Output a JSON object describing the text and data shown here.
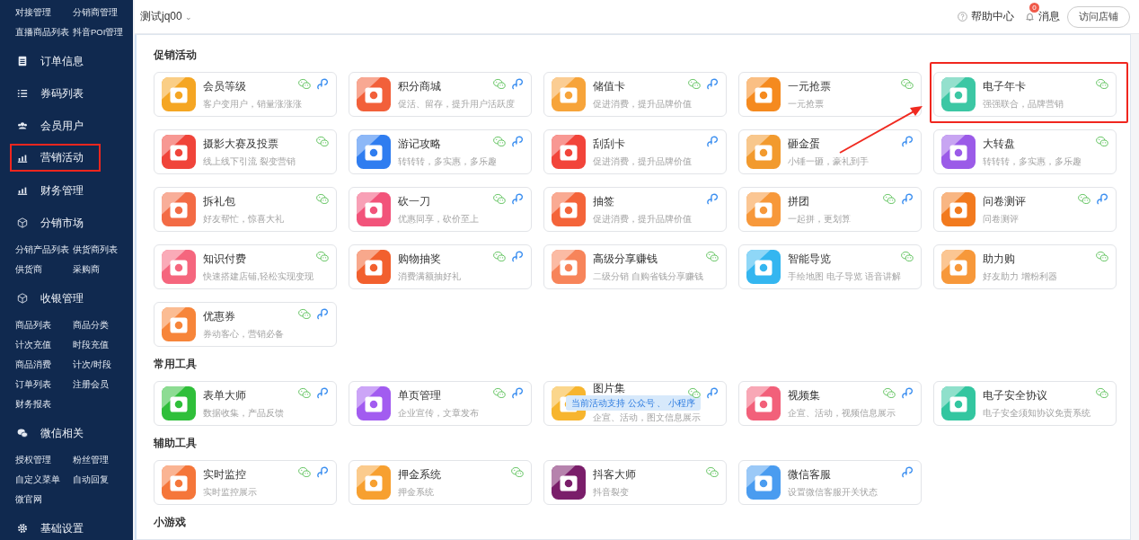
{
  "sidebar": [
    {
      "kind": "links",
      "links": [
        "对接管理",
        "分销商管理",
        "直播商品列表",
        "抖音POI管理"
      ]
    },
    {
      "kind": "menu",
      "label": "订单信息",
      "highlighted": false
    },
    {
      "kind": "menu",
      "label": "券码列表",
      "highlighted": false
    },
    {
      "kind": "menu",
      "label": "会员用户",
      "highlighted": false
    },
    {
      "kind": "menu",
      "label": "营销活动",
      "highlighted": true
    },
    {
      "kind": "menu",
      "label": "财务管理",
      "highlighted": false
    },
    {
      "kind": "menu",
      "label": "分销市场",
      "highlighted": false
    },
    {
      "kind": "links",
      "links": [
        "分销产品列表",
        "供货商列表",
        "供货商",
        "采购商"
      ]
    },
    {
      "kind": "menu",
      "label": "收银管理",
      "highlighted": false
    },
    {
      "kind": "links",
      "links": [
        "商品列表",
        "商品分类",
        "计次充值",
        "时段充值",
        "商品消费",
        "计次/时段",
        "订单列表",
        "注册会员",
        "财务报表"
      ]
    },
    {
      "kind": "menu",
      "label": "微信相关",
      "highlighted": false
    },
    {
      "kind": "links",
      "links": [
        "授权管理",
        "粉丝管理",
        "自定义菜单",
        "自动回复",
        "微官网"
      ]
    },
    {
      "kind": "menu",
      "label": "基础设置",
      "highlighted": false
    }
  ],
  "header": {
    "store": "测试jq00",
    "caret": "⌄",
    "help": "帮助中心",
    "messages": "消息",
    "message_badge": "0",
    "visit_button": "访问店铺"
  },
  "sections": [
    {
      "title": "促销活动",
      "cards": [
        {
          "title": "会员等级",
          "desc": "客户变用户，销量涨涨涨",
          "color": "#f5a623",
          "wechat": true,
          "miniprogram": true,
          "highlighted": false
        },
        {
          "title": "积分商城",
          "desc": "促活、留存，提升用户活跃度",
          "color": "#f2603a",
          "wechat": true,
          "miniprogram": true,
          "highlighted": false
        },
        {
          "title": "储值卡",
          "desc": "促进消费，提升品牌价值",
          "color": "#f7a43a",
          "wechat": true,
          "miniprogram": true,
          "highlighted": false
        },
        {
          "title": "一元抢票",
          "desc": "一元抢票",
          "color": "#f58a1f",
          "wechat": true,
          "miniprogram": false,
          "highlighted": false
        },
        {
          "title": "电子年卡",
          "desc": "强强联合，品牌营销",
          "color": "#3cc7a4",
          "wechat": true,
          "miniprogram": false,
          "highlighted": true
        },
        {
          "title": "摄影大赛及投票",
          "desc": "线上线下引流 裂变营销",
          "color": "#f0443a",
          "wechat": true,
          "miniprogram": false,
          "highlighted": false
        },
        {
          "title": "游记攻略",
          "desc": "转转转，多实惠，多乐趣",
          "color": "#2f7df0",
          "wechat": true,
          "miniprogram": true,
          "highlighted": false
        },
        {
          "title": "刮刮卡",
          "desc": "促进消费，提升品牌价值",
          "color": "#f2443a",
          "wechat": false,
          "miniprogram": true,
          "highlighted": false
        },
        {
          "title": "砸金蛋",
          "desc": "小锤一砸，豪礼到手",
          "color": "#f29a2e",
          "wechat": false,
          "miniprogram": true,
          "highlighted": false
        },
        {
          "title": "大转盘",
          "desc": "转转转，多实惠，多乐趣",
          "color": "#9b5be8",
          "wechat": true,
          "miniprogram": false,
          "highlighted": false
        },
        {
          "title": "拆礼包",
          "desc": "好友帮忙，惊喜大礼",
          "color": "#f36b45",
          "wechat": true,
          "miniprogram": false,
          "highlighted": false
        },
        {
          "title": "砍一刀",
          "desc": "优惠同享，砍价至上",
          "color": "#f2537a",
          "wechat": true,
          "miniprogram": true,
          "highlighted": false
        },
        {
          "title": "抽签",
          "desc": "促进消费，提升品牌价值",
          "color": "#f4643a",
          "wechat": false,
          "miniprogram": true,
          "highlighted": false
        },
        {
          "title": "拼团",
          "desc": "一起拼，更划算",
          "color": "#f7983a",
          "wechat": true,
          "miniprogram": true,
          "highlighted": false
        },
        {
          "title": "问卷测评",
          "desc": "问卷测评",
          "color": "#f27a1e",
          "wechat": true,
          "miniprogram": true,
          "highlighted": false
        },
        {
          "title": "知识付费",
          "desc": "快速搭建店铺,轻松实现变现",
          "color": "#f5667e",
          "wechat": true,
          "miniprogram": false,
          "highlighted": false
        },
        {
          "title": "购物抽奖",
          "desc": "消费满额抽好礼",
          "color": "#f2602e",
          "wechat": true,
          "miniprogram": true,
          "highlighted": false
        },
        {
          "title": "高级分享赚钱",
          "desc": "二级分销 自购省钱分享赚钱",
          "color": "#f7845a",
          "wechat": true,
          "miniprogram": false,
          "highlighted": false
        },
        {
          "title": "智能导览",
          "desc": "手绘地图 电子导览 语音讲解",
          "color": "#34b6f0",
          "wechat": true,
          "miniprogram": false,
          "highlighted": false
        },
        {
          "title": "助力购",
          "desc": "好友助力 增粉利器",
          "color": "#f7983a",
          "wechat": true,
          "miniprogram": false,
          "highlighted": false
        },
        {
          "title": "优惠券",
          "desc": "券动客心，营销必备",
          "color": "#f7853a",
          "wechat": true,
          "miniprogram": true,
          "highlighted": false
        }
      ]
    },
    {
      "title": "常用工具",
      "cards": [
        {
          "title": "表单大师",
          "desc": "数据收集，产品反馈",
          "color": "#2fbf3a",
          "wechat": true,
          "miniprogram": true,
          "highlighted": false
        },
        {
          "title": "单页管理",
          "desc": "企业宣传，文章发布",
          "color": "#a25cf0",
          "wechat": true,
          "miniprogram": true,
          "highlighted": false
        },
        {
          "title": "图片集",
          "desc": "企宣、活动，图文信息展示",
          "color": "#f7b52e",
          "wechat": true,
          "miniprogram": true,
          "highlighted": false,
          "tooltip": "当前活动支持 公众号 、 小程序"
        },
        {
          "title": "视频集",
          "desc": "企宣、活动，视频信息展示",
          "color": "#f2607a",
          "wechat": true,
          "miniprogram": true,
          "highlighted": false
        },
        {
          "title": "电子安全协议",
          "desc": "电子安全须知协议免责系统",
          "color": "#33c6a0",
          "wechat": true,
          "miniprogram": false,
          "highlighted": false
        }
      ]
    },
    {
      "title": "辅助工具",
      "cards": [
        {
          "title": "实时监控",
          "desc": "实时监控展示",
          "color": "#f5763a",
          "wechat": true,
          "miniprogram": true,
          "highlighted": false
        },
        {
          "title": "押金系统",
          "desc": "押金系统",
          "color": "#f7a030",
          "wechat": true,
          "miniprogram": false,
          "highlighted": false
        },
        {
          "title": "抖客大师",
          "desc": "抖音裂变",
          "color": "#7a1e6a",
          "wechat": true,
          "miniprogram": false,
          "highlighted": false
        },
        {
          "title": "微信客服",
          "desc": "设置微信客服开关状态",
          "color": "#4a9cf0",
          "wechat": false,
          "miniprogram": true,
          "highlighted": false
        }
      ]
    },
    {
      "title": "小游戏"
    }
  ]
}
